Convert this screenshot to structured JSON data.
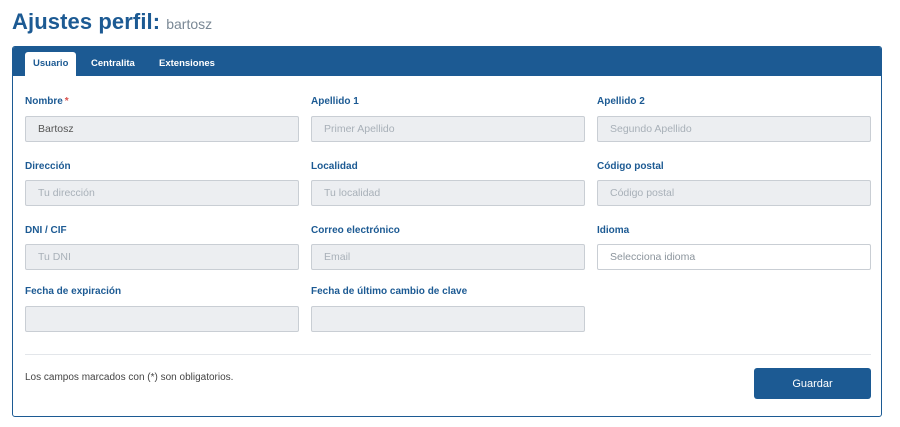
{
  "header": {
    "title": "Ajustes perfil:",
    "username": "bartosz"
  },
  "tabs": [
    {
      "label": "Usuario",
      "active": true
    },
    {
      "label": "Centralita",
      "active": false
    },
    {
      "label": "Extensiones",
      "active": false
    }
  ],
  "form": {
    "nombre": {
      "label": "Nombre",
      "required_mark": "*",
      "value": "Bartosz",
      "placeholder": ""
    },
    "apellido1": {
      "label": "Apellido 1",
      "value": "",
      "placeholder": "Primer Apellido"
    },
    "apellido2": {
      "label": "Apellido 2",
      "value": "",
      "placeholder": "Segundo Apellido"
    },
    "direccion": {
      "label": "Dirección",
      "value": "",
      "placeholder": "Tu dirección"
    },
    "localidad": {
      "label": "Localidad",
      "value": "",
      "placeholder": "Tu localidad"
    },
    "codigo_postal": {
      "label": "Código postal",
      "value": "",
      "placeholder": "Código postal"
    },
    "dni": {
      "label": "DNI / CIF",
      "value": "",
      "placeholder": "Tu DNI"
    },
    "correo": {
      "label": "Correo electrónico",
      "value": "",
      "placeholder": "Email"
    },
    "idioma": {
      "label": "Idioma",
      "value": "",
      "placeholder": "Selecciona idioma"
    },
    "fecha_expiracion": {
      "label": "Fecha de expiración",
      "value": "",
      "placeholder": ""
    },
    "fecha_cambio_clave": {
      "label": "Fecha de último cambio de clave",
      "value": "",
      "placeholder": ""
    }
  },
  "footer": {
    "note": "Los campos marcados con (*) son obligatorios.",
    "save_label": "Guardar"
  },
  "colors": {
    "brand": "#1c5a93",
    "required": "#d9534f",
    "input_disabled_bg": "#eceef1"
  }
}
